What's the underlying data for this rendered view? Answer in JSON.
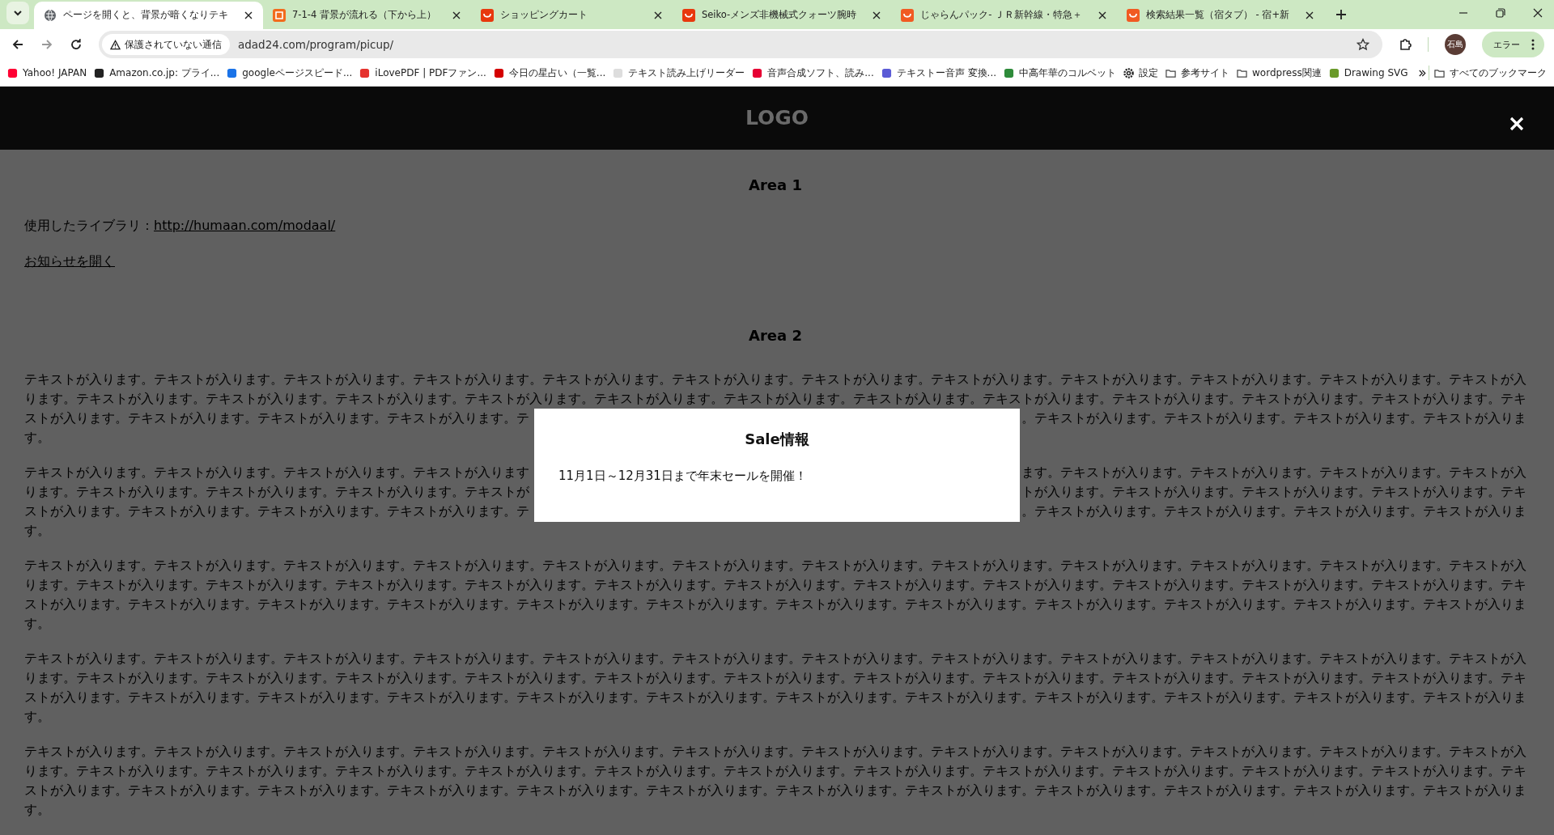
{
  "browser": {
    "tabs": [
      {
        "title": "ページを開くと、背景が暗くなりテキ",
        "selected": true,
        "kind": "globe",
        "color": "#5f6368"
      },
      {
        "title": "7-1-4 背景が流れる（下から上）",
        "selected": false,
        "kind": "app",
        "color": "#f26b1d"
      },
      {
        "title": "ショッピングカート",
        "selected": false,
        "kind": "shop",
        "color": "#e8380d"
      },
      {
        "title": "Seiko-メンズ非機械式クォーツ腕時",
        "selected": false,
        "kind": "shop",
        "color": "#e8380d"
      },
      {
        "title": "じゃらんパック- ＪＲ新幹線・特急＋",
        "selected": false,
        "kind": "shop",
        "color": "#f15a22"
      },
      {
        "title": "検索結果一覧（宿タブ） - 宿+新",
        "selected": false,
        "kind": "shop",
        "color": "#f15a22"
      }
    ],
    "security_label": "保護されていない通信",
    "url": "adad24.com/program/picup/",
    "profile_initials": "石島",
    "error_button": "エラー",
    "bookmarks": [
      {
        "label": "Yahoo! JAPAN",
        "kind": "site",
        "color": "#ff0033"
      },
      {
        "label": "Amazon.co.jp: プライ...",
        "kind": "site",
        "color": "#222222"
      },
      {
        "label": "googleページスピード...",
        "kind": "site",
        "color": "#1a73e8"
      },
      {
        "label": "iLovePDF | PDFファン...",
        "kind": "site",
        "color": "#e5322d"
      },
      {
        "label": "今日の星占い（一覧...",
        "kind": "site",
        "color": "#d40000"
      },
      {
        "label": "テキスト読み上げリーダー",
        "kind": "site",
        "color": "#dddddd"
      },
      {
        "label": "音声合成ソフト、読み...",
        "kind": "site",
        "color": "#e60033"
      },
      {
        "label": "テキストー音声 変換...",
        "kind": "site",
        "color": "#5b5bd6"
      },
      {
        "label": "中高年華のコルベット",
        "kind": "site",
        "color": "#2e8b3a"
      },
      {
        "label": "設定",
        "kind": "settings",
        "color": "#222222"
      },
      {
        "label": "参考サイト",
        "kind": "folder"
      },
      {
        "label": "wordpress関連",
        "kind": "folder"
      },
      {
        "label": "Drawing SVG",
        "kind": "site",
        "color": "#6a9a2a"
      }
    ],
    "other_bookmarks": "すべてのブックマーク"
  },
  "page": {
    "logo": "LOGO",
    "sections": [
      {
        "heading": "Area 1",
        "kind": "links",
        "library_label": "使用したライブラリ：",
        "library_link": "http://humaan.com/modaal/",
        "open_link": "お知らせを開く"
      },
      {
        "heading": "Area 2",
        "kind": "text",
        "paragraphs": [
          {
            "lines": [
              [
                "テキストが入ります。テキストが入ります。テキストが入ります。テキストが入ります。テキストが入ります。テキストが入ります。テキストが入ります。テキストが入ります。テキストが入ります。テキストが入ります。テキストが入ります。テキストが入"
              ],
              [
                "ります。テキストが入ります。テキストが入ります。テキストが入ります。テキストが入ります。テキストが入ります。テキストが入ります。テキストが入ります。テキストが入ります。テキストが入ります。テキストが入ります。テキストが入ります。テキ"
              ],
              [
                "ストが入ります。テキストが入ります。テキストが入ります。テキストが入ります。テ",
                "。テキストが入ります。テキストが入ります。テキストが入ります。テキストが入りま"
              ],
              [
                "す。"
              ]
            ]
          },
          {
            "lines": [
              [
                "テキストが入ります。テキストが入ります。テキストが入ります。テキストが入ります",
                "ます。テキストが入ります。テキストが入ります。テキストが入ります。テキストが入"
              ],
              [
                "ります。テキストが入ります。テキストが入ります。テキストが入ります。テキストが",
                "トが入ります。テキストが入ります。テキストが入ります。テキストが入ります。テキ"
              ],
              [
                "ストが入ります。テキストが入ります。テキストが入ります。テキストが入ります。テ",
                "。テキストが入ります。テキストが入ります。テキストが入ります。テキストが入りま"
              ],
              [
                "す。"
              ]
            ]
          },
          {
            "lines": [
              [
                "テキストが入ります。テキストが入ります。テキストが入ります。テキストが入ります。テキストが入ります。テキストが入ります。テキストが入ります。テキストが入ります。テキストが入ります。テキストが入ります。テキストが入ります。テキストが入"
              ],
              [
                "ります。テキストが入ります。テキストが入ります。テキストが入ります。テキストが入ります。テキストが入ります。テキストが入ります。テキストが入ります。テキストが入ります。テキストが入ります。テキストが入ります。テキストが入ります。テキ"
              ],
              [
                "ストが入ります。テキストが入ります。テキストが入ります。テキストが入ります。テキストが入ります。テキストが入ります。テキストが入ります。テキストが入ります。テキストが入ります。テキストが入ります。テキストが入ります。テキストが入りま"
              ],
              [
                "す。"
              ]
            ]
          },
          {
            "lines": [
              [
                "テキストが入ります。テキストが入ります。テキストが入ります。テキストが入ります。テキストが入ります。テキストが入ります。テキストが入ります。テキストが入ります。テキストが入ります。テキストが入ります。テキストが入ります。テキストが入"
              ],
              [
                "ります。テキストが入ります。テキストが入ります。テキストが入ります。テキストが入ります。テキストが入ります。テキストが入ります。テキストが入ります。テキストが入ります。テキストが入ります。テキストが入ります。テキストが入ります。テキ"
              ],
              [
                "ストが入ります。テキストが入ります。テキストが入ります。テキストが入ります。テキストが入ります。テキストが入ります。テキストが入ります。テキストが入ります。テキストが入ります。テキストが入ります。テキストが入ります。テキストが入りま"
              ],
              [
                "す。"
              ]
            ]
          },
          {
            "lines": [
              [
                "テキストが入ります。テキストが入ります。テキストが入ります。テキストが入ります。テキストが入ります。テキストが入ります。テキストが入ります。テキストが入ります。テキストが入ります。テキストが入ります。テキストが入ります。テキストが入"
              ],
              [
                "ります。テキストが入ります。テキストが入ります。テキストが入ります。テキストが入ります。テキストが入ります。テキストが入ります。テキストが入ります。テキストが入ります。テキストが入ります。テキストが入ります。テキストが入ります。テキ"
              ],
              [
                "ストが入ります。テキストが入ります。テキストが入ります。テキストが入ります。テキストが入ります。テキストが入ります。テキストが入ります。テキストが入ります。テキストが入ります。テキストが入ります。テキストが入ります。テキストが入りま"
              ],
              [
                "す。"
              ]
            ]
          }
        ]
      }
    ],
    "modal": {
      "title": "Sale情報",
      "body": "11月1日～12月31日まで年末セールを開催！"
    }
  }
}
